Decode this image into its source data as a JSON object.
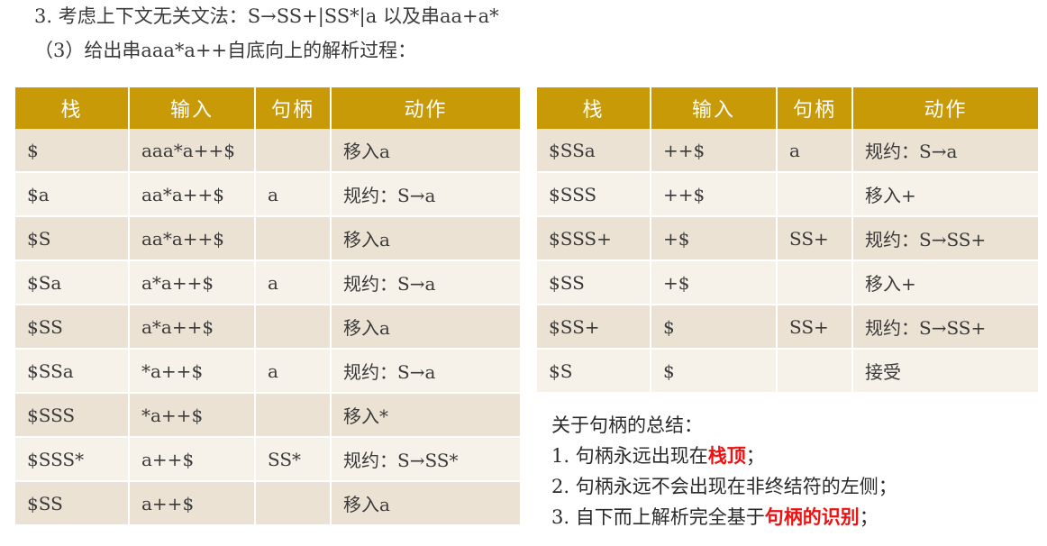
{
  "header": {
    "line1": "3. 考虑上下文无关文法：S→SS+|SS*|a 以及串aa+a*",
    "line2": "（3）给出串aaa*a++自底向上的解析过程："
  },
  "columns": [
    "栈",
    "输入",
    "句柄",
    "动作"
  ],
  "left_rows": [
    [
      "$",
      "aaa*a++$",
      "",
      "移入a"
    ],
    [
      "$a",
      "aa*a++$",
      "a",
      "规约：S→a"
    ],
    [
      "$S",
      "aa*a++$",
      "",
      "移入a"
    ],
    [
      "$Sa",
      "a*a++$",
      "a",
      "规约：S→a"
    ],
    [
      "$SS",
      "a*a++$",
      "",
      "移入a"
    ],
    [
      "$SSa",
      "*a++$",
      "a",
      "规约：S→a"
    ],
    [
      "$SSS",
      "*a++$",
      "",
      "移入*"
    ],
    [
      "$SSS*",
      "a++$",
      "SS*",
      "规约：S→SS*"
    ],
    [
      "$SS",
      "a++$",
      "",
      "移入a"
    ]
  ],
  "right_rows": [
    [
      "$SSa",
      "++$",
      "a",
      "规约：S→a"
    ],
    [
      "$SSS",
      "++$",
      "",
      "移入+"
    ],
    [
      "$SSS+",
      "+$",
      "SS+",
      "规约：S→SS+"
    ],
    [
      "$SS",
      "+$",
      "",
      "移入+"
    ],
    [
      "$SS+",
      "$",
      "SS+",
      "规约：S→SS+"
    ],
    [
      "$S",
      "$",
      "",
      "接受"
    ]
  ],
  "summary": {
    "title": "关于句柄的总结：",
    "item1_pre": "1. 句柄永远出现在",
    "item1_hl": "栈顶",
    "item1_post": "；",
    "item2": "2. 句柄永远不会出现在非终结符的左侧；",
    "item3_pre": "3. 自下而上解析完全基于",
    "item3_hl": "句柄的识别",
    "item3_post": "；"
  },
  "colors": {
    "header_bg": "#c89a08",
    "row_odd": "#ebe2d4",
    "row_even": "#f6f2ea",
    "highlight": "#ee1111"
  }
}
